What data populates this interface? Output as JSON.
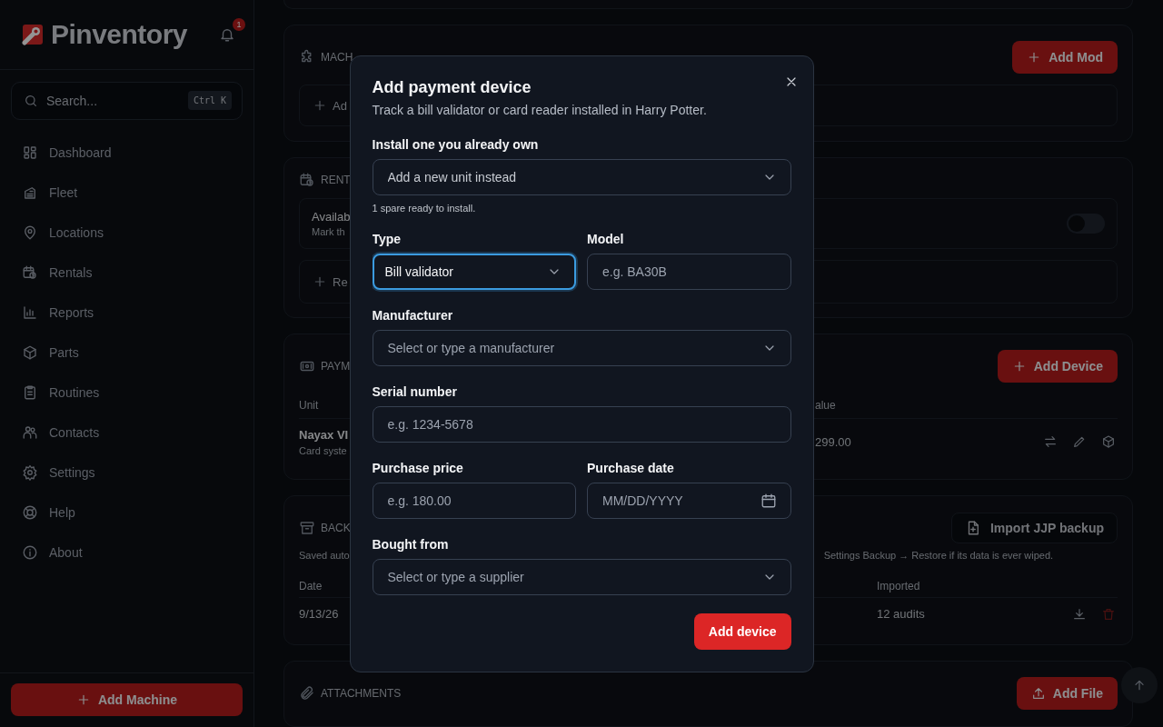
{
  "sidebar": {
    "brand": "Pinventory",
    "notification_count": "1",
    "search": {
      "placeholder": "Search...",
      "shortcut": "Ctrl K"
    },
    "nav": [
      {
        "label": "Dashboard"
      },
      {
        "label": "Fleet"
      },
      {
        "label": "Locations"
      },
      {
        "label": "Rentals"
      },
      {
        "label": "Reports"
      },
      {
        "label": "Parts"
      },
      {
        "label": "Routines"
      },
      {
        "label": "Contacts"
      },
      {
        "label": "Settings"
      },
      {
        "label": "Help"
      },
      {
        "label": "About"
      }
    ],
    "add_button": "Add Machine"
  },
  "main": {
    "machine_mods": {
      "title": "MACH",
      "button": "Add Mod",
      "add_row": "Ad"
    },
    "rentals": {
      "title": "RENT",
      "available": {
        "title": "Availab",
        "description": "Mark th",
        "on": false
      },
      "add_row": "Re"
    },
    "payment_devices": {
      "title": "PAYM",
      "button": "Add Device",
      "columns": [
        "Unit",
        "alue"
      ],
      "rows": [
        {
          "unit": "Nayax VI",
          "subtitle": "Card syste",
          "value": "299.00"
        }
      ]
    },
    "backups": {
      "title": "BACK",
      "button": "Import JJP backup",
      "note_left": "Saved auto",
      "note_right": "Settings Backup → Restore if its data is ever wiped.",
      "columns": [
        "Date",
        "Imported"
      ],
      "rows": [
        {
          "date": "9/13/26",
          "imported": "12 audits"
        }
      ]
    },
    "attachments": {
      "title": "ATTACHMENTS",
      "button": "Add File"
    }
  },
  "dialog": {
    "title": "Add payment device",
    "subtitle": "Track a bill validator or card reader installed in Harry Potter.",
    "rows": [
      [
        {
          "label": "Install one you already own",
          "kind": "select",
          "value": "Add a new unit instead",
          "help": "1 spare ready to install.",
          "focused": false
        }
      ],
      [
        {
          "label": "Type",
          "kind": "select",
          "value": "Bill validator",
          "focused": true
        },
        {
          "label": "Model",
          "kind": "input",
          "placeholder": "e.g. BA30B",
          "focused": false
        }
      ],
      [
        {
          "label": "Manufacturer",
          "kind": "select",
          "placeholder": "Select or type a manufacturer",
          "focused": false
        }
      ],
      [
        {
          "label": "Serial number",
          "kind": "input",
          "placeholder": "e.g. 1234-5678",
          "focused": false
        }
      ],
      [
        {
          "label": "Purchase price",
          "kind": "input",
          "placeholder": "e.g. 180.00",
          "focused": false
        },
        {
          "label": "Purchase date",
          "kind": "date",
          "placeholder": "MM/DD/YYYY",
          "focused": false
        }
      ],
      [
        {
          "label": "Bought from",
          "kind": "select",
          "placeholder": "Select or type a supplier",
          "focused": false
        }
      ]
    ],
    "submit": "Add device"
  }
}
